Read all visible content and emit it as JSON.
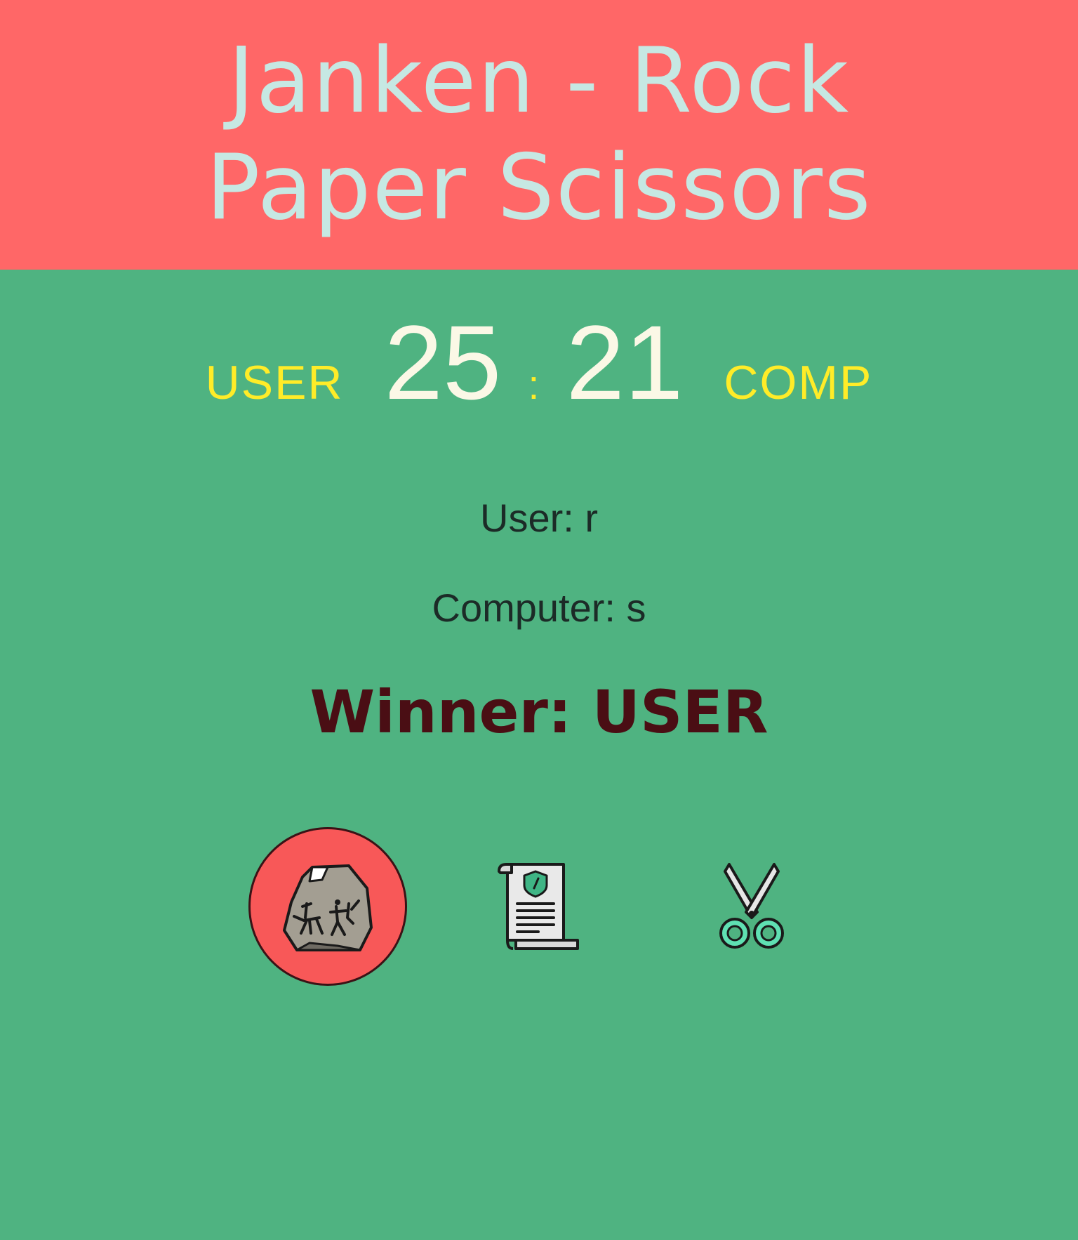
{
  "header": {
    "title": "Janken - Rock Paper Scissors"
  },
  "scoreboard": {
    "user_label": "USER",
    "user_score": "25",
    "separator": ":",
    "comp_score": "21",
    "comp_label": "COMP"
  },
  "round": {
    "user_move": "User: r",
    "computer_move": "Computer: s",
    "winner": "Winner: USER"
  },
  "choices": [
    {
      "name": "rock",
      "icon": "rock-icon",
      "selected": true
    },
    {
      "name": "paper",
      "icon": "paper-scroll-icon",
      "selected": false
    },
    {
      "name": "scissors",
      "icon": "scissors-icon",
      "selected": false
    }
  ],
  "colors": {
    "header_bg": "#ff6767",
    "page_bg": "#4fb381",
    "title": "#c6e8e3",
    "label_yellow": "#ffec28",
    "score": "#fbf8e6",
    "winner": "#4a0e14",
    "selected_bg": "#f85858"
  }
}
